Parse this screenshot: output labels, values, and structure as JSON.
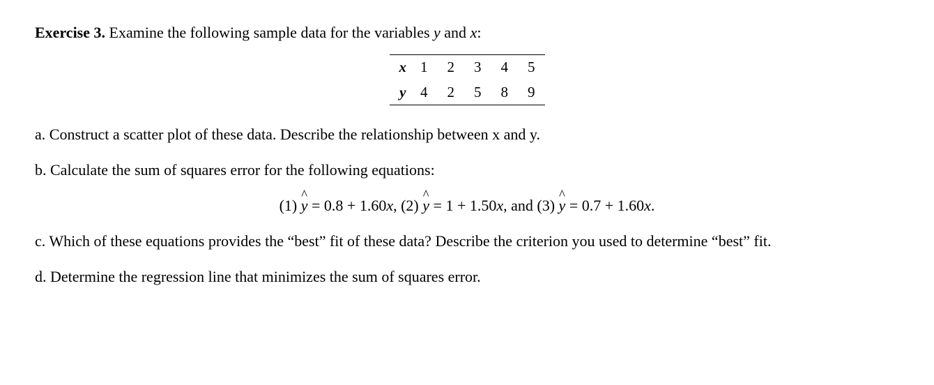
{
  "heading": {
    "label": "Exercise 3.",
    "text": "Examine the following sample data for the variables",
    "var_y": "y",
    "and": "and",
    "var_x": "x",
    "colon": ":"
  },
  "table": {
    "row1_label": "x",
    "row1": [
      "1",
      "2",
      "3",
      "4",
      "5"
    ],
    "row2_label": "y",
    "row2": [
      "4",
      "2",
      "5",
      "8",
      "9"
    ]
  },
  "part_a": {
    "label": "a.",
    "text1": " Construct a scatter plot of these data. Describe the relationship between x and y."
  },
  "part_b": {
    "label": "b.",
    "text1": " Calculate the sum of squares error for the following equations:"
  },
  "equations": {
    "eq1_num": "(1) ",
    "eq1_rhs": " = 0.8 + 1.60",
    "eq2_num": ", (2) ",
    "eq2_rhs": " = 1 + 1.50",
    "eq3_num": ", and (3) ",
    "eq3_rhs": " = 0.7 + 1.60",
    "x": "x",
    "period": "."
  },
  "part_c": {
    "label": "c.",
    "text1": " Which of these equations provides the “best” fit of these data? Describe the criterion you used to determine “best” fit."
  },
  "part_d": {
    "label": "d.",
    "text1": " Determine the regression line that minimizes the sum of squares error."
  }
}
